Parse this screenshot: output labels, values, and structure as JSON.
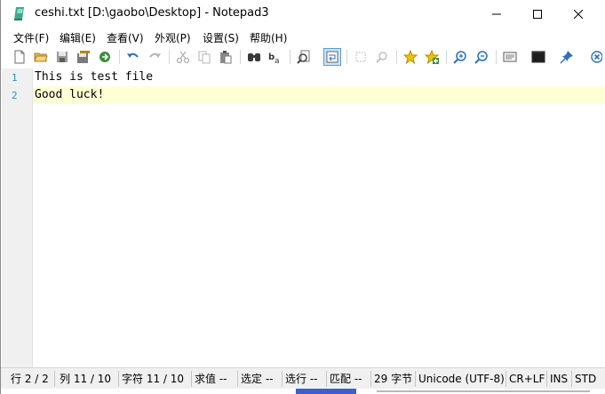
{
  "window": {
    "title": "ceshi.txt [D:\\gaobo\\Desktop] - Notepad3"
  },
  "menu": [
    "文件(F)",
    "编辑(E)",
    "查看(V)",
    "外观(P)",
    "设置(S)",
    "帮助(H)"
  ],
  "toolbar_icons": [
    "new-file-icon",
    "open-folder-icon",
    "save-icon",
    "save-as-icon",
    "browse-icon",
    "undo-icon",
    "redo-icon",
    "cut-icon",
    "copy-icon",
    "paste-icon",
    "find-icon",
    "replace-icon",
    "goto-icon",
    "word-wrap-icon",
    "select-icon",
    "find-select-icon",
    "bookmark-icon",
    "bookmark-add-icon",
    "zoom-in-icon",
    "zoom-out-icon",
    "scheme-icon",
    "console-icon",
    "pin-icon",
    "close-file-icon"
  ],
  "editor": {
    "line_numbers": [
      "1",
      "2"
    ],
    "lines": [
      "This is test file",
      "Good luck!"
    ],
    "current_line": 2
  },
  "status": {
    "row": "行 2 / 2",
    "col": "列 11 / 10",
    "char": "字符 11 / 10",
    "sum": "求值 --",
    "sel": "选定 --",
    "selline": "选行 --",
    "match": "匹配 --",
    "bytes": "29 字节",
    "encoding": "Unicode (UTF-8)",
    "eol": "CR+LF",
    "ins": "INS",
    "mode": "STD"
  },
  "colors": {
    "current_line_highlight": "#ffffd6",
    "line_number": "#2b91af",
    "gutter_bg": "#f0f0f0",
    "statusbar_bg": "#f0f0f0"
  }
}
